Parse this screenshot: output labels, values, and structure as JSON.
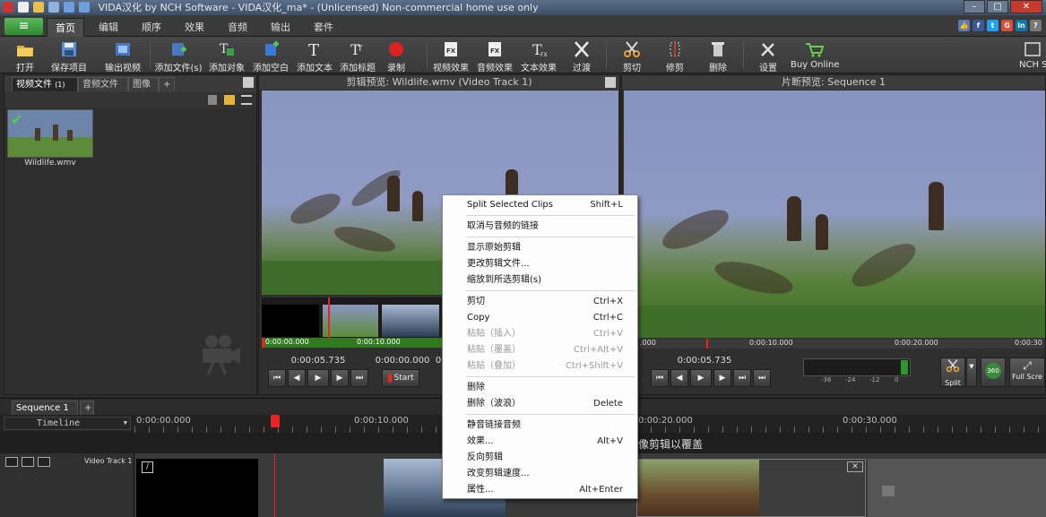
{
  "titlebar": {
    "title": "VIDA汉化 by NCH Software - VIDA汉化_ma* - (Unlicensed) Non-commercial home use only"
  },
  "menu": {
    "tabs": [
      {
        "label": "首页",
        "active": true
      },
      {
        "label": "编辑"
      },
      {
        "label": "顺序"
      },
      {
        "label": "效果"
      },
      {
        "label": "音频"
      },
      {
        "label": "输出"
      },
      {
        "label": "套件"
      }
    ]
  },
  "toolbar": {
    "open": "打开",
    "save_project": "保存项目",
    "export_video": "输出视频",
    "add_files": "添加文件(s)",
    "add_object": "添加对象",
    "add_blank": "添加空白",
    "add_text": "添加文本",
    "add_title": "添加标题",
    "record": "录制",
    "video_effects": "视频效果",
    "audio_effects": "音频效果",
    "text_effects": "文本效果",
    "transition": "过渡",
    "cut": "剪切",
    "trim": "修剪",
    "delete": "删除",
    "settings": "设置",
    "buy_online": "Buy Online",
    "nch_suite": "NCH S"
  },
  "bin": {
    "tabs": [
      "视频文件",
      "音频文件",
      "图像",
      "+"
    ],
    "video_tab_count": "(1)",
    "clip_name": "Wildlife.wmv"
  },
  "clip_preview": {
    "header": "剪辑预览: Wildlife.wmv (Video Track 1)",
    "tc_start": "0:00:00.000",
    "tc_mid": "0:00:10.000",
    "position": "0:00:05.735",
    "position2": "0:00:00.000",
    "position3": "0",
    "start_label": "Start"
  },
  "sequence_preview": {
    "header": "片断预览: Sequence 1",
    "tc_0": ".000",
    "tc_10": "0:00:10.000",
    "tc_20": "0:00:20.000",
    "tc_30": "0:00:30",
    "position": "0:00:05.735",
    "meter_ticks": [
      "-36",
      "-24",
      "-12",
      "0"
    ],
    "split_label": "Split",
    "btn_360": "360",
    "fullscreen_label": "Full Scre"
  },
  "context_menu": {
    "items": [
      {
        "label": "Split Selected Clips",
        "shortcut": "Shift+L"
      },
      {
        "label": "取消与音频的链接",
        "shortcut": ""
      },
      {
        "label": "显示原始剪辑",
        "shortcut": ""
      },
      {
        "label": "更改剪辑文件...",
        "shortcut": ""
      },
      {
        "label": "缩放到所选剪辑(s)",
        "shortcut": ""
      },
      {
        "label": "剪切",
        "shortcut": "Ctrl+X"
      },
      {
        "label": "Copy",
        "shortcut": "Ctrl+C"
      },
      {
        "label": "粘贴（插入）",
        "shortcut": "Ctrl+V"
      },
      {
        "label": "粘贴（覆盖）",
        "shortcut": "Ctrl+Alt+V"
      },
      {
        "label": "粘贴（叠加）",
        "shortcut": "Ctrl+Shift+V"
      },
      {
        "label": "删除",
        "shortcut": ""
      },
      {
        "label": "删除（波浪）",
        "shortcut": "Delete"
      },
      {
        "label": "静音链接音频",
        "shortcut": ""
      },
      {
        "label": "效果...",
        "shortcut": "Alt+V"
      },
      {
        "label": "反向剪辑",
        "shortcut": ""
      },
      {
        "label": "改变剪辑速度...",
        "shortcut": ""
      },
      {
        "label": "属性...",
        "shortcut": "Alt+Enter"
      }
    ]
  },
  "timeline": {
    "sequence_tab": "Sequence 1",
    "timeline_dropdown": "Timeline",
    "ruler": [
      "0:00:00.000",
      "0:00:10.000",
      "0:00:20.000",
      "0:00:30.000"
    ],
    "overlay_hint": "像剪辑以覆盖",
    "video_track": "Video Track 1"
  }
}
